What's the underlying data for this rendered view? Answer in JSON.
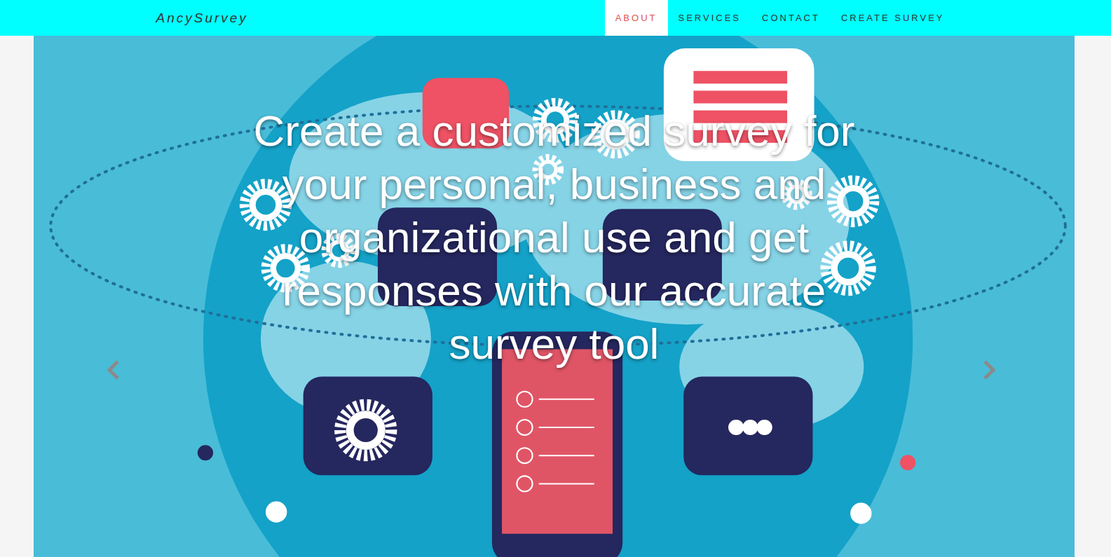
{
  "navbar": {
    "brand": "AncySurvey",
    "items": [
      {
        "label": "ABOUT",
        "selected": true
      },
      {
        "label": "SERVICES",
        "selected": false
      },
      {
        "label": "CONTACT",
        "selected": false
      },
      {
        "label": "CREATE SURVEY",
        "selected": false
      }
    ]
  },
  "carousel": {
    "headline": "Create a customized survey for your personal, business and organizational use and get responses with our accurate survey tool"
  }
}
